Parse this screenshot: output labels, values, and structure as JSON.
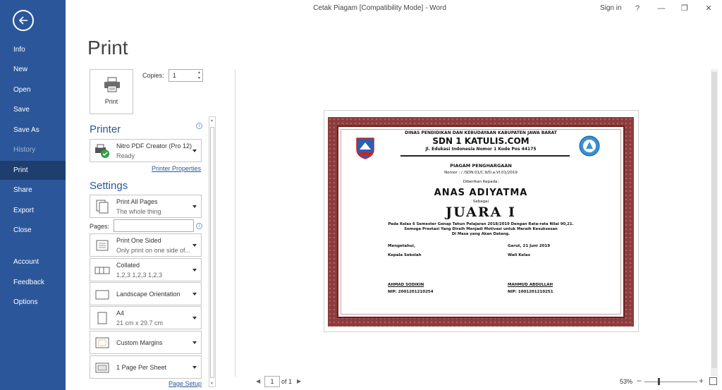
{
  "window": {
    "title": "Cetak Piagam [Compatibility Mode]  -  Word",
    "sign_in": "Sign in",
    "help": "?",
    "minimize": "—",
    "restore": "❐",
    "close": "✕"
  },
  "sidebar": {
    "items": [
      {
        "label": "Info"
      },
      {
        "label": "New"
      },
      {
        "label": "Open"
      },
      {
        "label": "Save"
      },
      {
        "label": "Save As"
      },
      {
        "label": "History"
      },
      {
        "label": "Print"
      },
      {
        "label": "Share"
      },
      {
        "label": "Export"
      },
      {
        "label": "Close"
      },
      {
        "label": "Account"
      },
      {
        "label": "Feedback"
      },
      {
        "label": "Options"
      }
    ]
  },
  "page_heading": "Print",
  "print_button_label": "Print",
  "copies": {
    "label": "Copies:",
    "value": "1"
  },
  "printer": {
    "section_title": "Printer",
    "name": "Nitro PDF Creator (Pro 12)",
    "status": "Ready",
    "properties_link": "Printer Properties"
  },
  "settings": {
    "section_title": "Settings",
    "pages_label": "Pages:",
    "pages_value": "",
    "items": [
      {
        "line1": "Print All Pages",
        "line2": "The whole thing"
      },
      {
        "line1": "Print One Sided",
        "line2": "Only print on one side of..."
      },
      {
        "line1": "Collated",
        "line2": "1,2,3    1,2,3    1,2,3"
      },
      {
        "line1": "Landscape Orientation",
        "line2": ""
      },
      {
        "line1": "A4",
        "line2": "21 cm x 29.7 cm"
      },
      {
        "line1": "Custom Margins",
        "line2": ""
      },
      {
        "line1": "1 Page Per Sheet",
        "line2": ""
      }
    ],
    "page_setup_link": "Page Setup"
  },
  "certificate": {
    "agency": "DINAS PENDIDIKAN DAN KEBUDAYAAN KABUPATEN JAWA BARAT",
    "school": "SDN 1 KATULIS.COM",
    "address": "Jl. Edukasi Indonesia Nomor 1 Kode Pos 44175",
    "award_title": "PIAGAM PENGHARGAAN",
    "number": "Nomor :       /        /SDN.01/C.9/D.a.VI.01/2019",
    "given_to": "Diberikan Kepada:",
    "recipient": "ANAS ADIYATMA",
    "as": "Sebagai",
    "rank": "JUARA I",
    "body_1": "Pada Kelas 6 Semester Genap Tahun Pelajaran 2018/2019 Dengan Rata-rata Nilai 90,21.",
    "body_2": "Semoga Prestasi Yang Diraih Menjadi Motivasi untuk Meraih Kesuksesan",
    "body_3": "Di Masa yang Akan Datang.",
    "left_acknowledged": "Mengetahui,",
    "left_role": "Kepala Sekolah",
    "left_name": "AHMAD SODIKIN",
    "left_nip": "NIP: 2001201210254",
    "right_place_date": "Garut, 21 Juni 2019",
    "right_role": "Wali Kelas",
    "right_name": "MAHMUD ABDULLAH",
    "right_nip": "NIP: 1001201210251"
  },
  "pager": {
    "current": "1",
    "of": "of 1"
  },
  "zoom": {
    "percent": "53%",
    "level": 0.53
  },
  "colors": {
    "accent": "#2b579a",
    "frame": "#8c3c3c"
  }
}
